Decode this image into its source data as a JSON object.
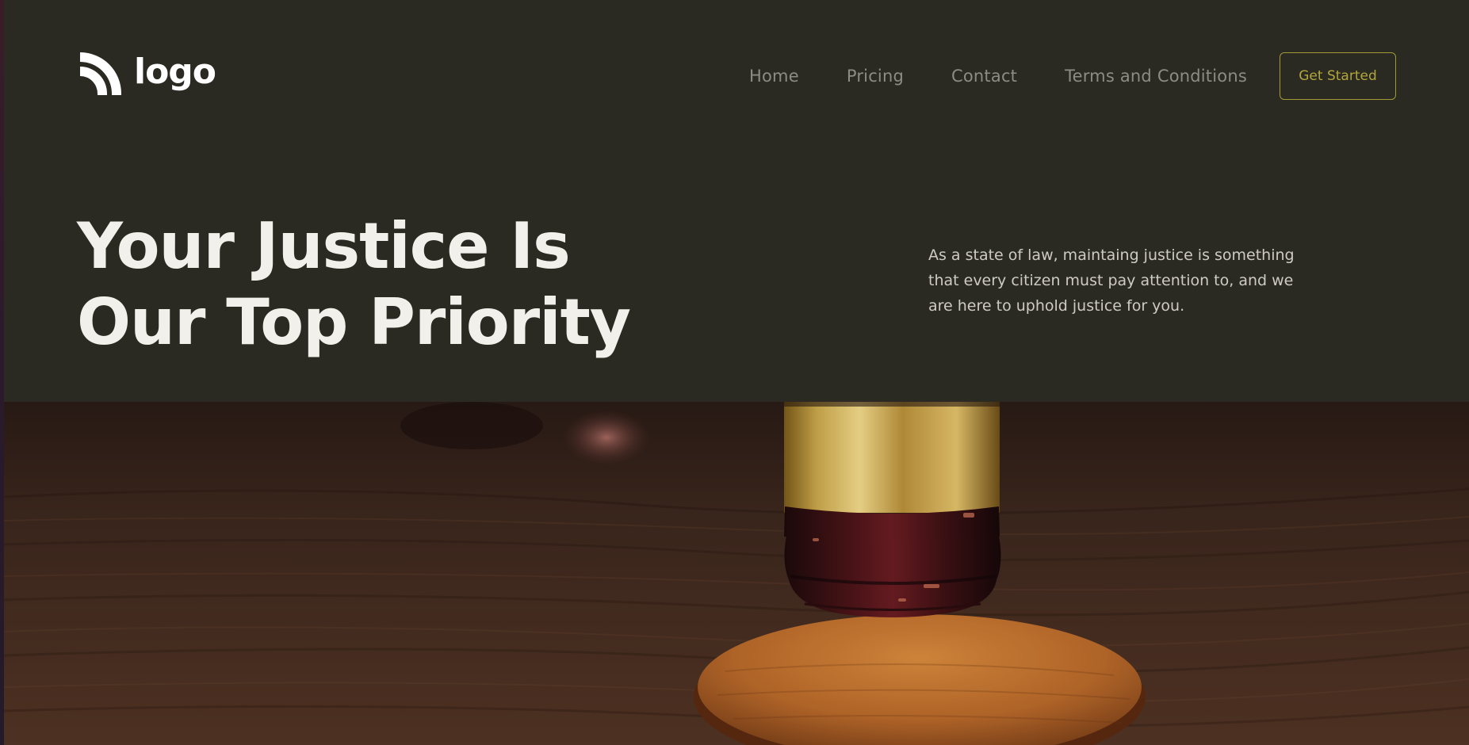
{
  "header": {
    "logo_text": "logo",
    "nav": [
      {
        "label": "Home"
      },
      {
        "label": "Pricing"
      },
      {
        "label": "Contact"
      },
      {
        "label": "Terms and Conditions"
      }
    ],
    "cta_label": "Get Started"
  },
  "hero": {
    "title_line1": "Your Justice Is",
    "title_line2": "Our Top Priority",
    "description": "As a state of law, maintaing justice is something that every citizen must pay attention to, and we are here to uphold justice for you."
  },
  "colors": {
    "background": "#2a2922",
    "accent": "#b2a63c",
    "title": "#f2f0ea",
    "nav_text": "#8e8b82"
  }
}
